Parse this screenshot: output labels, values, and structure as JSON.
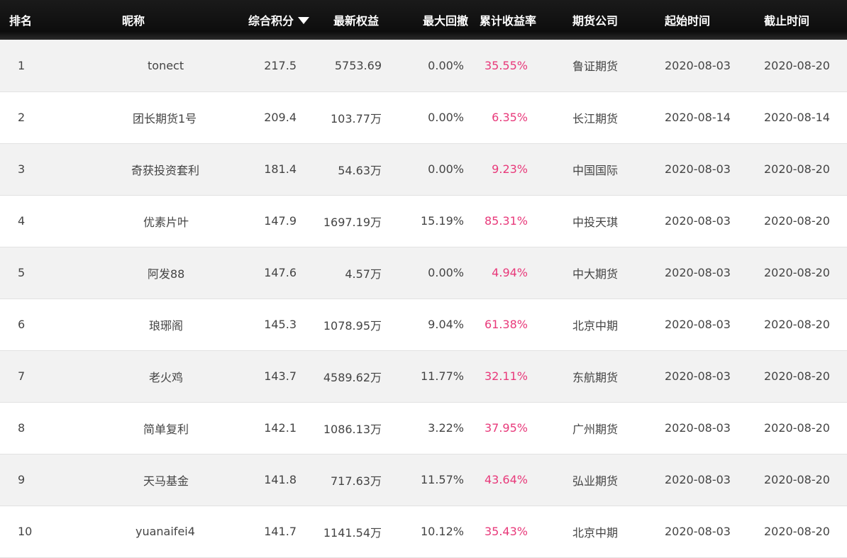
{
  "header": {
    "rank": "排名",
    "nickname": "昵称",
    "score": "综合积分",
    "equity": "最新权益",
    "drawdown": "最大回撤",
    "return": "累计收益率",
    "company": "期货公司",
    "start": "起始时间",
    "end": "截止时间",
    "sort_icon": "triangle-down-icon"
  },
  "colors": {
    "header_bg": "#111111",
    "row_alt_bg": "#f2f2f2",
    "return_text": "#e8397a",
    "body_text": "#444444"
  },
  "rows": [
    {
      "rank": "1",
      "nickname": "tonect",
      "score": "217.5",
      "equity": "5753.69",
      "drawdown": "0.00%",
      "return": "35.55%",
      "company": "鲁证期货",
      "start": "2020-08-03",
      "end": "2020-08-20"
    },
    {
      "rank": "2",
      "nickname": "团长期货1号",
      "score": "209.4",
      "equity": "103.77万",
      "drawdown": "0.00%",
      "return": "6.35%",
      "company": "长江期货",
      "start": "2020-08-14",
      "end": "2020-08-14"
    },
    {
      "rank": "3",
      "nickname": "奇获投资套利",
      "score": "181.4",
      "equity": "54.63万",
      "drawdown": "0.00%",
      "return": "9.23%",
      "company": "中国国际",
      "start": "2020-08-03",
      "end": "2020-08-20"
    },
    {
      "rank": "4",
      "nickname": "优素片叶",
      "score": "147.9",
      "equity": "1697.19万",
      "drawdown": "15.19%",
      "return": "85.31%",
      "company": "中投天琪",
      "start": "2020-08-03",
      "end": "2020-08-20"
    },
    {
      "rank": "5",
      "nickname": "阿发88",
      "score": "147.6",
      "equity": "4.57万",
      "drawdown": "0.00%",
      "return": "4.94%",
      "company": "中大期货",
      "start": "2020-08-03",
      "end": "2020-08-20"
    },
    {
      "rank": "6",
      "nickname": "琅琊阁",
      "score": "145.3",
      "equity": "1078.95万",
      "drawdown": "9.04%",
      "return": "61.38%",
      "company": "北京中期",
      "start": "2020-08-03",
      "end": "2020-08-20"
    },
    {
      "rank": "7",
      "nickname": "老火鸡",
      "score": "143.7",
      "equity": "4589.62万",
      "drawdown": "11.77%",
      "return": "32.11%",
      "company": "东航期货",
      "start": "2020-08-03",
      "end": "2020-08-20"
    },
    {
      "rank": "8",
      "nickname": "简单复利",
      "score": "142.1",
      "equity": "1086.13万",
      "drawdown": "3.22%",
      "return": "37.95%",
      "company": "广州期货",
      "start": "2020-08-03",
      "end": "2020-08-20"
    },
    {
      "rank": "9",
      "nickname": "天马基金",
      "score": "141.8",
      "equity": "717.63万",
      "drawdown": "11.57%",
      "return": "43.64%",
      "company": "弘业期货",
      "start": "2020-08-03",
      "end": "2020-08-20"
    },
    {
      "rank": "10",
      "nickname": "yuanaifei4",
      "score": "141.7",
      "equity": "1141.54万",
      "drawdown": "10.12%",
      "return": "35.43%",
      "company": "北京中期",
      "start": "2020-08-03",
      "end": "2020-08-20"
    }
  ]
}
